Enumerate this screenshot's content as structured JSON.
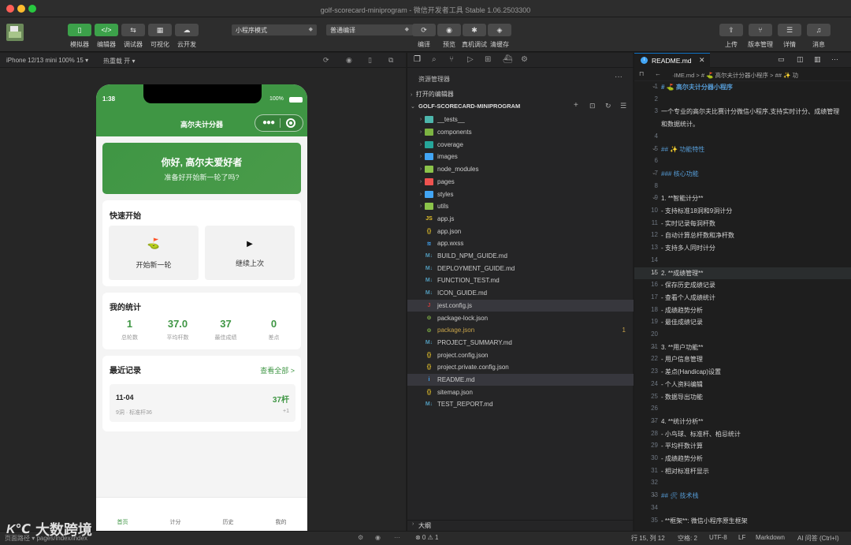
{
  "window": {
    "title": "golf-scorecard-miniprogram - 微信开发者工具 Stable 1.06.2503300"
  },
  "toolbar": {
    "left_buttons": [
      {
        "label": "模拟器",
        "icon": "phone-icon",
        "active": true
      },
      {
        "label": "编辑器",
        "icon": "code-icon",
        "active": true
      },
      {
        "label": "调试器",
        "icon": "debug-icon",
        "active": false
      },
      {
        "label": "可视化",
        "icon": "layout-icon",
        "active": false
      },
      {
        "label": "云开发",
        "icon": "cloud-icon",
        "active": false
      }
    ],
    "mode_select": "小程序模式",
    "compile_select": "普通编译",
    "center_buttons": [
      {
        "label": "编译",
        "icon": "refresh-icon"
      },
      {
        "label": "预览",
        "icon": "eye-icon"
      },
      {
        "label": "真机调试",
        "icon": "bug-icon"
      },
      {
        "label": "清缓存",
        "icon": "layers-icon"
      }
    ],
    "right_buttons": [
      {
        "label": "上传",
        "icon": "upload-icon"
      },
      {
        "label": "版本管理",
        "icon": "branch-icon"
      },
      {
        "label": "详情",
        "icon": "list-icon"
      },
      {
        "label": "消息",
        "icon": "bell-icon"
      }
    ]
  },
  "simulator": {
    "device": "iPhone 12/13 mini 100% 15 ▾",
    "hot_reload": "热重载 开 ▾",
    "status_time": "1:38",
    "battery": "100%",
    "nav_title": "高尔夫计分器",
    "hero": {
      "title": "你好, 高尔夫爱好者",
      "subtitle": "准备好开始新一轮了吗?"
    },
    "quick_start": {
      "heading": "快速开始",
      "items": [
        {
          "icon": "⛳",
          "label": "开始新一轮"
        },
        {
          "icon": "▶",
          "label": "继续上次"
        }
      ]
    },
    "stats": {
      "heading": "我的统计",
      "items": [
        {
          "value": "1",
          "label": "总轮数"
        },
        {
          "value": "37.0",
          "label": "平均杆数"
        },
        {
          "value": "37",
          "label": "最佳成绩"
        },
        {
          "value": "0",
          "label": "差点"
        }
      ]
    },
    "recent": {
      "heading": "最近记录",
      "view_all": "查看全部 >",
      "record": {
        "date": "11-04",
        "detail": "9洞 · 标准杆36",
        "score": "37杆",
        "diff": "+1"
      }
    },
    "tabbar": [
      "首页",
      "计分",
      "历史",
      "我的"
    ]
  },
  "explorer": {
    "title": "资源管理器",
    "open_editors": "打开的编辑器",
    "project": "GOLF-SCORECARD-MINIPROGRAM",
    "folders": [
      {
        "name": "__tests__",
        "color": "#4db6ac"
      },
      {
        "name": "components",
        "color": "#7cb342"
      },
      {
        "name": "coverage",
        "color": "#26a69a"
      },
      {
        "name": "images",
        "color": "#42a5f5"
      },
      {
        "name": "node_modules",
        "color": "#8bc34a"
      },
      {
        "name": "pages",
        "color": "#ef5350"
      },
      {
        "name": "styles",
        "color": "#42a5f5"
      },
      {
        "name": "utils",
        "color": "#8bc34a"
      }
    ],
    "files": [
      {
        "name": "app.js",
        "icon": "JS",
        "color": "#e6c229",
        "text_color": "#cccccc"
      },
      {
        "name": "app.json",
        "icon": "{}",
        "color": "#e6c229",
        "text_color": "#cccccc"
      },
      {
        "name": "app.wxss",
        "icon": "≋",
        "color": "#42a5f5",
        "text_color": "#cccccc"
      },
      {
        "name": "BUILD_NPM_GUIDE.md",
        "icon": "M↓",
        "color": "#519aba",
        "text_color": "#cccccc"
      },
      {
        "name": "DEPLOYMENT_GUIDE.md",
        "icon": "M↓",
        "color": "#519aba",
        "text_color": "#cccccc"
      },
      {
        "name": "FUNCTION_TEST.md",
        "icon": "M↓",
        "color": "#519aba",
        "text_color": "#cccccc"
      },
      {
        "name": "ICON_GUIDE.md",
        "icon": "M↓",
        "color": "#519aba",
        "text_color": "#cccccc"
      },
      {
        "name": "jest.config.js",
        "icon": "J",
        "color": "#c23d3d",
        "text_color": "#cccccc",
        "selected": true
      },
      {
        "name": "package-lock.json",
        "icon": "⊙",
        "color": "#8bc34a",
        "text_color": "#cccccc"
      },
      {
        "name": "package.json",
        "icon": "⊙",
        "color": "#8bc34a",
        "text_color": "#c7a34a",
        "badge": "1"
      },
      {
        "name": "PROJECT_SUMMARY.md",
        "icon": "M↓",
        "color": "#519aba",
        "text_color": "#cccccc"
      },
      {
        "name": "project.config.json",
        "icon": "{}",
        "color": "#e6c229",
        "text_color": "#cccccc"
      },
      {
        "name": "project.private.config.json",
        "icon": "{}",
        "color": "#e6c229",
        "text_color": "#cccccc"
      },
      {
        "name": "README.md",
        "icon": "i",
        "color": "#42a5f5",
        "text_color": "#cccccc",
        "selected": true
      },
      {
        "name": "sitemap.json",
        "icon": "{}",
        "color": "#e6c229",
        "text_color": "#cccccc"
      },
      {
        "name": "TEST_REPORT.md",
        "icon": "M↓",
        "color": "#519aba",
        "text_color": "#cccccc"
      }
    ],
    "outline": "大纲",
    "problems": "⊗ 0 ⚠ 1"
  },
  "editor": {
    "tab": "README.md",
    "breadcrumb": "·IME.md > # ⛳ 高尔夫计分器小程序 > ## ✨ 功",
    "lines": [
      {
        "n": "1",
        "text": "# ⛳ 高尔夫计分器小程序",
        "kind": "h1"
      },
      {
        "n": "2",
        "text": "",
        "kind": "plain"
      },
      {
        "n": "3",
        "text": "一个专业的高尔夫比赛计分微信小程序,支持实时计分、成绩管理",
        "kind": "plain"
      },
      {
        "n": "",
        "text": "和数据统计。",
        "kind": "plain"
      },
      {
        "n": "4",
        "text": "",
        "kind": "plain"
      },
      {
        "n": "5",
        "text": "## ✨ 功能特性",
        "kind": "h2"
      },
      {
        "n": "6",
        "text": "",
        "kind": "plain"
      },
      {
        "n": "7",
        "text": "### 核心功能",
        "kind": "h2"
      },
      {
        "n": "8",
        "text": "",
        "kind": "plain"
      },
      {
        "n": "9",
        "text": "1. **智能计分**",
        "kind": "num"
      },
      {
        "n": "10",
        "text": "   - 支持标准18洞和9洞计分",
        "kind": "li"
      },
      {
        "n": "11",
        "text": "   - 实时记录每洞杆数",
        "kind": "li"
      },
      {
        "n": "12",
        "text": "   - 自动计算总杆数和净杆数",
        "kind": "li"
      },
      {
        "n": "13",
        "text": "   - 支持多人同时计分",
        "kind": "li"
      },
      {
        "n": "14",
        "text": "",
        "kind": "plain"
      },
      {
        "n": "15",
        "text": "2. **成绩管理**",
        "kind": "num",
        "current": true
      },
      {
        "n": "16",
        "text": "   - 保存历史成绩记录",
        "kind": "li"
      },
      {
        "n": "17",
        "text": "   - 查看个人成绩统计",
        "kind": "li"
      },
      {
        "n": "18",
        "text": "   - 成绩趋势分析",
        "kind": "li"
      },
      {
        "n": "19",
        "text": "   - 最佳成绩记录",
        "kind": "li"
      },
      {
        "n": "20",
        "text": "",
        "kind": "plain"
      },
      {
        "n": "21",
        "text": "3. **用户功能**",
        "kind": "num"
      },
      {
        "n": "22",
        "text": "   - 用户信息管理",
        "kind": "li"
      },
      {
        "n": "23",
        "text": "   - 差点(Handicap)设置",
        "kind": "li"
      },
      {
        "n": "24",
        "text": "   - 个人资料编辑",
        "kind": "li"
      },
      {
        "n": "25",
        "text": "   - 数据导出功能",
        "kind": "li"
      },
      {
        "n": "26",
        "text": "",
        "kind": "plain"
      },
      {
        "n": "27",
        "text": "4. **统计分析**",
        "kind": "num"
      },
      {
        "n": "28",
        "text": "   - 小鸟球、标准杆、柏忌统计",
        "kind": "li"
      },
      {
        "n": "29",
        "text": "   - 平均杆数计算",
        "kind": "li"
      },
      {
        "n": "30",
        "text": "   - 成绩趋势分析",
        "kind": "li"
      },
      {
        "n": "31",
        "text": "   - 相对标准杆显示",
        "kind": "li"
      },
      {
        "n": "32",
        "text": "",
        "kind": "plain"
      },
      {
        "n": "33",
        "text": "## 🛠 技术栈",
        "kind": "h2"
      },
      {
        "n": "34",
        "text": "",
        "kind": "plain"
      },
      {
        "n": "35",
        "text": "- **框架**: 微信小程序原生框架",
        "kind": "li2"
      }
    ]
  },
  "statusbar": {
    "path": "页面路径 ▾  pages/index/index",
    "position": "行 15, 列 12",
    "spaces": "空格: 2",
    "encoding": "UTF-8",
    "eol": "LF",
    "lang": "Markdown",
    "ai": "AI 问答 (Ctrl+I)"
  },
  "watermark": "大数跨境",
  "colors": {
    "accent_green": "#3f9644",
    "brand_green": "#4a9b4a"
  }
}
